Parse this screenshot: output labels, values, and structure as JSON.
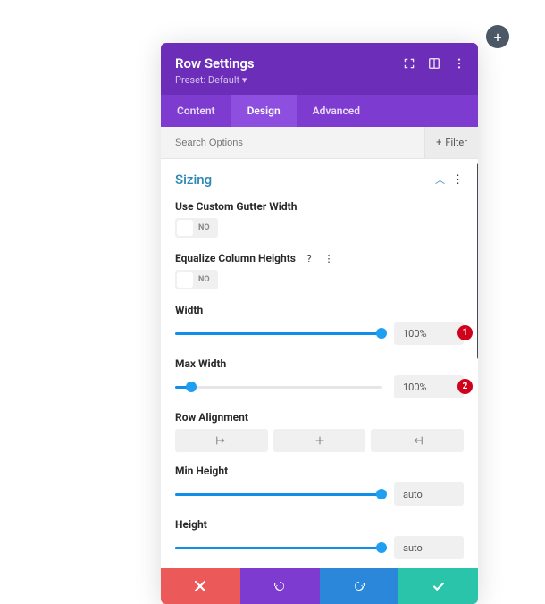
{
  "add_tooltip": "+",
  "header": {
    "title": "Row Settings",
    "preset_label": "Preset:",
    "preset_value": "Default",
    "icons": {
      "expand": "expand-icon",
      "responsive": "responsive-icon",
      "more": "more-vertical-icon"
    }
  },
  "tabs": {
    "items": [
      "Content",
      "Design",
      "Advanced"
    ],
    "active_index": 1
  },
  "search": {
    "placeholder": "Search Options",
    "filter_label": "Filter"
  },
  "section": {
    "title": "Sizing"
  },
  "fields": {
    "gutter": {
      "label": "Use Custom Gutter Width",
      "value_label": "NO",
      "state": false
    },
    "equalize": {
      "label": "Equalize Column Heights",
      "value_label": "NO",
      "state": false
    },
    "width": {
      "label": "Width",
      "value": "100%",
      "pct": 100,
      "badge": "1"
    },
    "maxwidth": {
      "label": "Max Width",
      "value": "100%",
      "pct": 8,
      "badge": "2"
    },
    "alignment": {
      "label": "Row Alignment",
      "options": [
        "left",
        "center",
        "right"
      ]
    },
    "minheight": {
      "label": "Min Height",
      "value": "auto",
      "pct": 100
    },
    "height": {
      "label": "Height",
      "value": "auto",
      "pct": 100
    }
  },
  "footer_actions": {
    "cancel": "cancel",
    "undo": "undo",
    "redo": "redo",
    "save": "save"
  }
}
